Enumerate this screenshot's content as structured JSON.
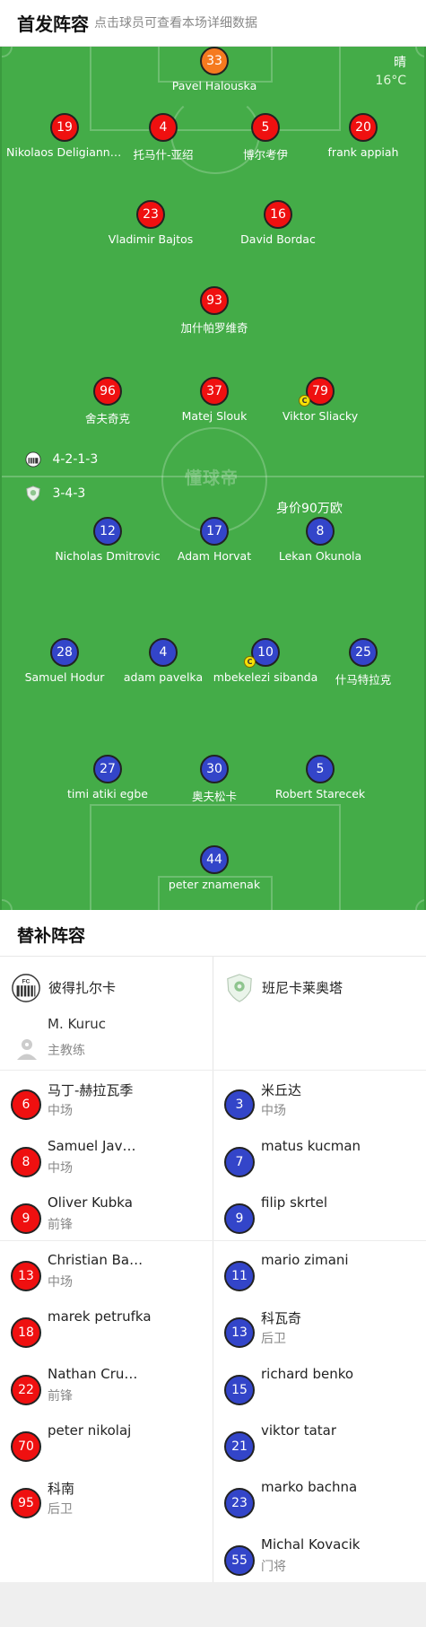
{
  "header": {
    "title": "首发阵容",
    "subtitle": "点击球员可查看本场详细数据"
  },
  "weather": {
    "condition": "晴",
    "temperature": "16°C"
  },
  "watermark": "懂球帝",
  "home_lineup": [
    {
      "number": "33",
      "name": "Pavel Halouska",
      "color": "orange"
    },
    {
      "number": "19",
      "name": "Nikolaos Deligianni...",
      "color": "red"
    },
    {
      "number": "4",
      "name": "托马什-亚绍",
      "color": "red"
    },
    {
      "number": "5",
      "name": "博尔考伊",
      "color": "red"
    },
    {
      "number": "20",
      "name": "frank appiah",
      "color": "red"
    },
    {
      "number": "23",
      "name": "Vladimir Bajtos",
      "color": "red"
    },
    {
      "number": "16",
      "name": "David Bordac",
      "color": "red"
    },
    {
      "number": "93",
      "name": "加什帕罗维奇",
      "color": "red"
    },
    {
      "number": "96",
      "name": "舍夫奇克",
      "color": "red"
    },
    {
      "number": "37",
      "name": "Matej Slouk",
      "color": "red"
    },
    {
      "number": "79",
      "name": "Viktor Sliacky",
      "color": "red",
      "captain": true
    }
  ],
  "away_lineup": [
    {
      "number": "12",
      "name": "Nicholas Dmitrovic",
      "color": "blue"
    },
    {
      "number": "17",
      "name": "Adam Horvat",
      "color": "blue"
    },
    {
      "number": "8",
      "name": "Lekan Okunola",
      "color": "blue"
    },
    {
      "number": "28",
      "name": "Samuel Hodur",
      "color": "blue"
    },
    {
      "number": "4",
      "name": "adam pavelka",
      "color": "blue"
    },
    {
      "number": "10",
      "name": "mbekelezi sibanda",
      "color": "blue",
      "captain": true
    },
    {
      "number": "25",
      "name": "什马特拉克",
      "color": "blue"
    },
    {
      "number": "27",
      "name": "timi atiki egbe",
      "color": "blue"
    },
    {
      "number": "30",
      "name": "奥夫松卡",
      "color": "blue"
    },
    {
      "number": "5",
      "name": "Robert Starecek",
      "color": "blue"
    },
    {
      "number": "44",
      "name": "peter znamenak",
      "color": "blue"
    }
  ],
  "captain_mark": "C",
  "formations": {
    "home": "4-2-1-3",
    "away": "3-4-3"
  },
  "market_value": "身价90万欧",
  "subs": {
    "title": "替补阵容",
    "home_team": "彼得扎尔卡",
    "away_team": "班尼卡莱奥塔",
    "coach": {
      "name": "M. Kuruc",
      "role": "主教练"
    },
    "home": [
      {
        "number": "6",
        "name": "马丁-赫拉瓦季",
        "position": "中场"
      },
      {
        "number": "8",
        "name": "Samuel Javorček",
        "position": "中场"
      },
      {
        "number": "9",
        "name": "Oliver Kubka",
        "position": "前锋"
      },
      {
        "number": "13",
        "name": "Christian Bacinsky",
        "position": "中场"
      },
      {
        "number": "18",
        "name": "marek petrufka",
        "position": ""
      },
      {
        "number": "22",
        "name": "Nathan Crucenic",
        "position": "前锋"
      },
      {
        "number": "70",
        "name": "peter nikolaj",
        "position": ""
      },
      {
        "number": "95",
        "name": "科南",
        "position": "后卫"
      }
    ],
    "away": [
      {
        "number": "3",
        "name": "米丘达",
        "position": "中场"
      },
      {
        "number": "7",
        "name": "matus kucman",
        "position": ""
      },
      {
        "number": "9",
        "name": "filip skrtel",
        "position": ""
      },
      {
        "number": "11",
        "name": "mario zimani",
        "position": ""
      },
      {
        "number": "13",
        "name": "科瓦奇",
        "position": "后卫"
      },
      {
        "number": "15",
        "name": "richard benko",
        "position": ""
      },
      {
        "number": "21",
        "name": "viktor tatar",
        "position": ""
      },
      {
        "number": "23",
        "name": "marko bachna",
        "position": ""
      },
      {
        "number": "55",
        "name": "Michal Kovacik",
        "position": "门将"
      }
    ]
  }
}
